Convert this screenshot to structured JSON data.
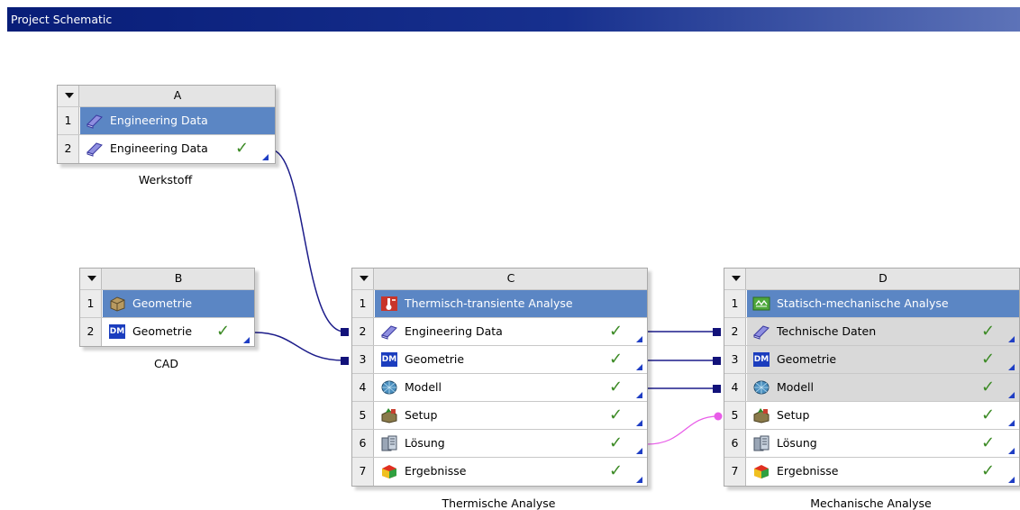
{
  "panel": {
    "title": "Project Schematic"
  },
  "systems": {
    "A": {
      "column": "A",
      "caption": "Werkstoff",
      "rows": [
        {
          "num": "1",
          "label": "Engineering Data",
          "icon": "book-icon"
        },
        {
          "num": "2",
          "label": "Engineering Data",
          "icon": "book-icon",
          "status": "✓"
        }
      ]
    },
    "B": {
      "column": "B",
      "caption": "CAD",
      "rows": [
        {
          "num": "1",
          "label": "Geometrie",
          "icon": "geometry-box-icon"
        },
        {
          "num": "2",
          "label": "Geometrie",
          "icon": "designmodeler-icon",
          "badge": "DM",
          "status": "✓"
        }
      ]
    },
    "C": {
      "column": "C",
      "caption": "Thermische Analyse",
      "rows": [
        {
          "num": "1",
          "label": "Thermisch-transiente Analyse",
          "icon": "thermal-transient-icon"
        },
        {
          "num": "2",
          "label": "Engineering Data",
          "icon": "book-icon",
          "status": "✓"
        },
        {
          "num": "3",
          "label": "Geometrie",
          "icon": "designmodeler-icon",
          "badge": "DM",
          "status": "✓"
        },
        {
          "num": "4",
          "label": "Modell",
          "icon": "mesh-model-icon",
          "status": "✓"
        },
        {
          "num": "5",
          "label": "Setup",
          "icon": "setup-icon",
          "status": "✓"
        },
        {
          "num": "6",
          "label": "Lösung",
          "icon": "solution-icon",
          "status": "✓"
        },
        {
          "num": "7",
          "label": "Ergebnisse",
          "icon": "results-icon",
          "status": "✓"
        }
      ]
    },
    "D": {
      "column": "D",
      "caption": "Mechanische Analyse",
      "rows": [
        {
          "num": "1",
          "label": "Statisch-mechanische Analyse",
          "icon": "static-structural-icon"
        },
        {
          "num": "2",
          "label": "Technische Daten",
          "icon": "book-icon",
          "status": "✓"
        },
        {
          "num": "3",
          "label": "Geometrie",
          "icon": "designmodeler-icon",
          "badge": "DM",
          "status": "✓"
        },
        {
          "num": "4",
          "label": "Modell",
          "icon": "mesh-model-icon",
          "status": "✓"
        },
        {
          "num": "5",
          "label": "Setup",
          "icon": "setup-icon",
          "status": "✓"
        },
        {
          "num": "6",
          "label": "Lösung",
          "icon": "solution-icon",
          "status": "✓"
        },
        {
          "num": "7",
          "label": "Ergebnisse",
          "icon": "results-icon",
          "status": "✓"
        }
      ]
    }
  },
  "colors": {
    "titlebar": "#0d2480",
    "header_row_selected": "#5b86c4",
    "link_line": "#1c1c8a",
    "transfer_line": "#e85ce8",
    "check": "#3b8a24"
  }
}
